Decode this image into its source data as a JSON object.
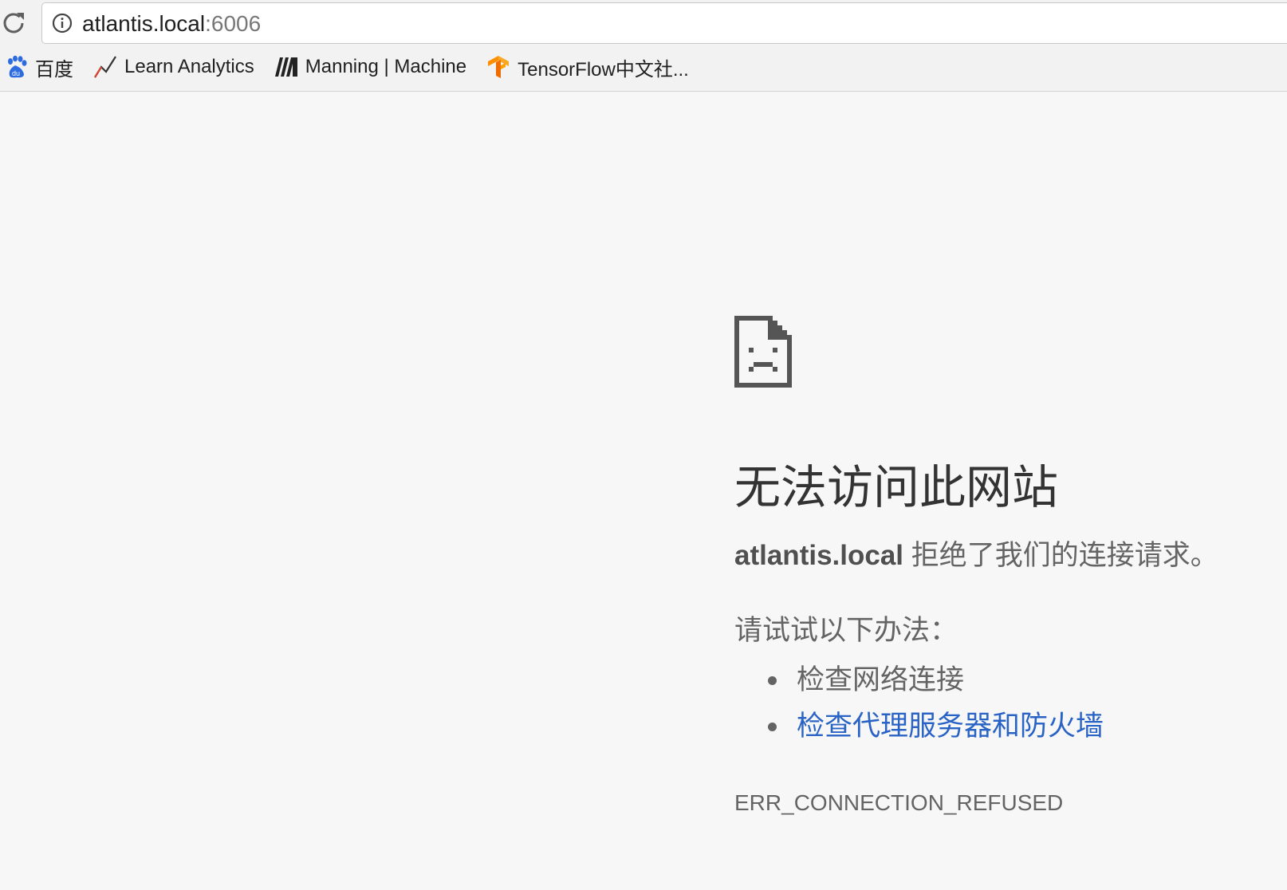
{
  "address_bar": {
    "host": "atlantis.local",
    "port": ":6006"
  },
  "bookmarks": [
    {
      "label": "百度",
      "icon": "baidu-paw-icon"
    },
    {
      "label": "Learn Analytics",
      "icon": "chart-line-icon"
    },
    {
      "label": "Manning | Machine",
      "icon": "manning-logo-icon"
    },
    {
      "label": "TensorFlow中文社...",
      "icon": "tensorflow-logo-icon"
    }
  ],
  "error_page": {
    "icon": "sad-page-icon",
    "title": "无法访问此网站",
    "host": "atlantis.local",
    "message": " 拒绝了我们的连接请求。",
    "suggestions_heading": "请试试以下办法：",
    "suggestions": [
      {
        "text": "检查网络连接",
        "link": false
      },
      {
        "text": "检查代理服务器和防火墙",
        "link": true
      }
    ],
    "error_code": "ERR_CONNECTION_REFUSED"
  },
  "colors": {
    "page_background": "#f7f7f7",
    "link": "#2a63c6",
    "text": "#646464"
  }
}
